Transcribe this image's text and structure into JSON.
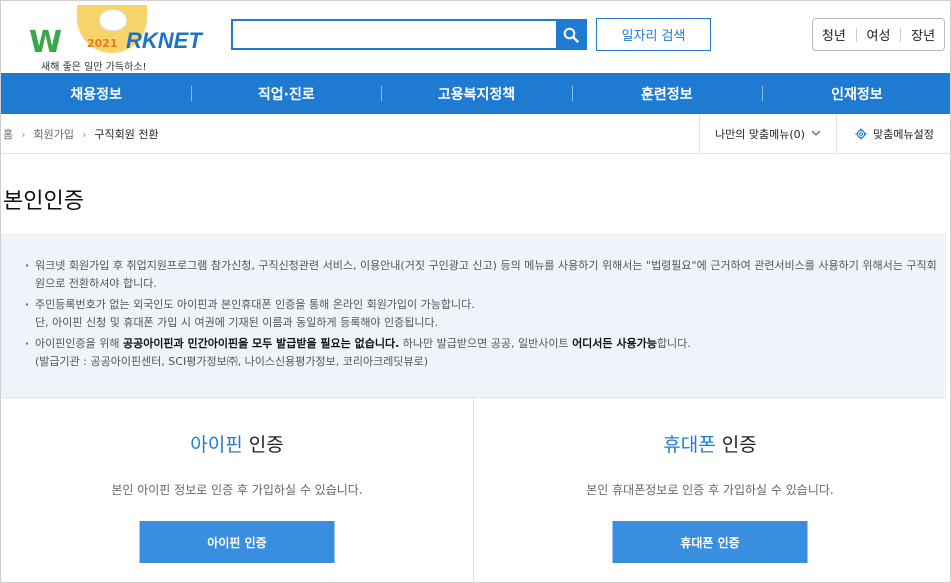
{
  "logo": {
    "year": "2021",
    "brand": "RKNET",
    "slogan": "새해 좋은 일만 가득하소!"
  },
  "search": {
    "value": "",
    "placeholder": "",
    "jobs_button": "일자리 검색"
  },
  "audience": [
    "청년",
    "여성",
    "장년"
  ],
  "gnb": [
    "채용정보",
    "직업·진로",
    "고용복지정책",
    "훈련정보",
    "인재정보"
  ],
  "breadcrumb": [
    "홈",
    "회원가입",
    "구직회원 전환"
  ],
  "mymenu": {
    "label": "나만의 맞춤메뉴(0)",
    "settings": "맞춤메뉴설정"
  },
  "page_title": "본인인증",
  "notice": {
    "item1": "워크넷 회원가입 후 취업지원프로그램 참가신청, 구직신청관련 서비스, 이용안내(거짓 구인광고 신고) 등의 메뉴를 사용하기 위해서는 \"법령필요\"에 근거하여 관련서비스를 사용하기 위해서는 구직회원으로 전환하셔야 합니다.",
    "item2_line1": "주민등록번호가 없는 외국인도 아이핀과 본인휴대폰 인증을 통해 온라인 회원가입이 가능합니다.",
    "item2_line2": "단, 아이핀 신청 및 휴대폰 가입 시 여권에 기재된 이름과 동일하게 등록해야 인증됩니다.",
    "item3_pre": "아이핀인증을 위해 ",
    "item3_bold1": "공공아이핀과 민간아이핀을 모두 발급받을 필요는 없습니다.",
    "item3_mid": " 하나만 발급받으면 공공, 일반사이트 ",
    "item3_bold2": "어디서든 사용가능",
    "item3_post": "합니다.",
    "item3_line2": "(발급기관 : 공공아이핀센터, SCI평가정보㈜, 나이스신용평가정보, 코리아크레딧뷰로)"
  },
  "ipin": {
    "title_hl": "아이핀",
    "title_rest": " 인증",
    "desc": "본인 아이핀 정보로 인증 후 가입하실 수 있습니다.",
    "button": "아이핀 인증"
  },
  "phone": {
    "title_hl": "휴대폰",
    "title_rest": " 인증",
    "desc": "본인 휴대폰정보로 인증 후 가입하실 수 있습니다.",
    "button": "휴대폰 인증"
  },
  "colors": {
    "primary": "#1e7bd1",
    "button": "#3a8ee0",
    "notice_bg": "#eef4f9",
    "logo_green": "#3aa84a",
    "sun": "#f6d46a"
  }
}
